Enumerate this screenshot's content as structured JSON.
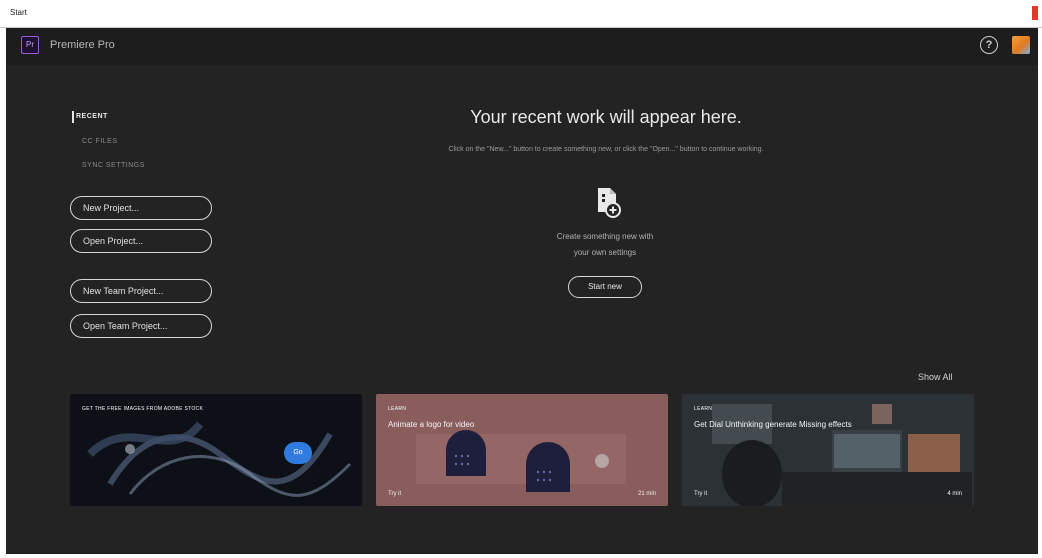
{
  "os_window": {
    "title": "Start"
  },
  "app": {
    "name": "Premiere Pro",
    "logo_text": "Pr"
  },
  "nav": {
    "recent": "RECENT",
    "cc_files": "CC FILES",
    "sync_settings": "SYNC SETTINGS"
  },
  "buttons": {
    "new_project": "New Project...",
    "open_project": "Open Project...",
    "new_team_project": "New Team Project...",
    "open_team_project": "Open Team Project..."
  },
  "center": {
    "heading": "Your recent work will appear here.",
    "subtext": "Click on the \"New...\" button to create something new, or click the \"Open...\" button to continue working.",
    "create_line1": "Create something new with",
    "create_line2": "your own settings",
    "start_new": "Start new"
  },
  "show_all": "Show All",
  "cards": [
    {
      "top_label": "GET THE FREE IMAGES FROM ADOBE STOCK",
      "cta": "Go"
    },
    {
      "top_label": "LEARN",
      "title": "Animate a logo for video",
      "bottom_left": "Try it",
      "bottom_right": "21 min"
    },
    {
      "top_label": "LEARN",
      "title": "Get Dial Unthinking generate Missing effects",
      "bottom_left": "Try it",
      "bottom_right": "4 min"
    }
  ],
  "colors": {
    "app_bg": "#232323",
    "header_bg": "#1d1d1d",
    "accent_pr": "#9a5cd9",
    "card2_bg": "#8a5d5d",
    "go_badge": "#2f7be0"
  }
}
